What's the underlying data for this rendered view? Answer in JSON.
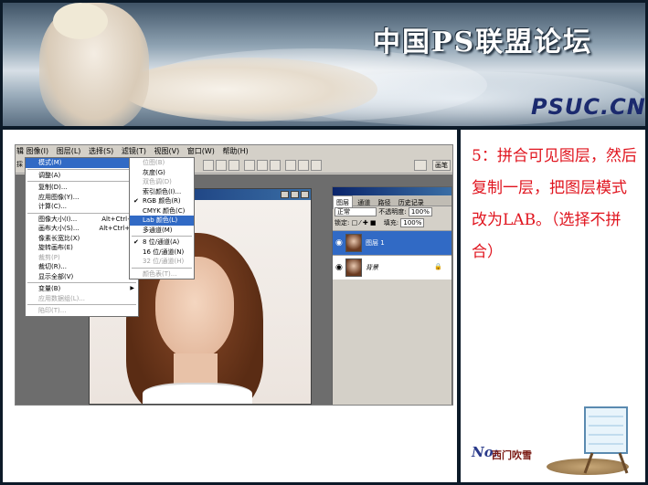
{
  "banner": {
    "title": "中国PS联盟论坛",
    "url": "PSUC.CN"
  },
  "ps": {
    "menubar": [
      "图像(I)",
      "图层(L)",
      "选择(S)",
      "滤镜(T)",
      "视图(V)",
      "窗口(W)",
      "帮助(H)"
    ],
    "left_partial": "辑",
    "tool_label": "採",
    "brush_label": "画笔"
  },
  "image_menu": [
    {
      "label": "模式(M)",
      "state": "sel",
      "arrow": true
    },
    {
      "sep": true
    },
    {
      "label": "调整(A)",
      "arrow": true
    },
    {
      "sep": true
    },
    {
      "label": "复制(D)..."
    },
    {
      "label": "应用图像(Y)..."
    },
    {
      "label": "计算(C)..."
    },
    {
      "sep": true
    },
    {
      "label": "图像大小(I)...",
      "shortcut": "Alt+Ctrl+I"
    },
    {
      "label": "画布大小(S)...",
      "shortcut": "Alt+Ctrl+C"
    },
    {
      "label": "像素长宽比(X)",
      "arrow": true
    },
    {
      "label": "旋转画布(E)",
      "arrow": true
    },
    {
      "label": "裁剪(P)",
      "state": "dis"
    },
    {
      "label": "裁切(R)..."
    },
    {
      "label": "显示全部(V)"
    },
    {
      "sep": true
    },
    {
      "label": "变量(B)",
      "arrow": true
    },
    {
      "label": "应用数据组(L)...",
      "state": "dis"
    },
    {
      "sep": true
    },
    {
      "label": "陷印(T)...",
      "state": "dis"
    }
  ],
  "mode_menu": [
    {
      "label": "位图(B)",
      "state": "dis"
    },
    {
      "label": "灰度(G)"
    },
    {
      "label": "双色调(D)",
      "state": "dis"
    },
    {
      "label": "索引颜色(I)..."
    },
    {
      "label": "RGB 颜色(R)",
      "check": true
    },
    {
      "label": "CMYK 颜色(C)"
    },
    {
      "label": "Lab 颜色(L)",
      "state": "sel"
    },
    {
      "label": "多通道(M)"
    },
    {
      "sep": true
    },
    {
      "label": "8 位/通道(A)",
      "check": true
    },
    {
      "label": "16 位/通道(N)"
    },
    {
      "label": "32 位/通道(H)",
      "state": "dis"
    },
    {
      "sep": true
    },
    {
      "label": "颜色表(T)...",
      "state": "dis"
    }
  ],
  "layers": {
    "tabs": [
      "图层",
      "通道",
      "路径",
      "历史记录"
    ],
    "blend_mode": "正常",
    "opacity_label": "不透明度:",
    "opacity": "100%",
    "lock_label": "锁定:",
    "fill_label": "填充:",
    "fill": "100%",
    "items": [
      {
        "name": "图层 1",
        "selected": true
      },
      {
        "name": "背景",
        "selected": false,
        "locked": true
      }
    ]
  },
  "step": {
    "text": "5：拼合可见图层，然后复制一层，把图层模式改为LAB。（选择不拼合）"
  },
  "logo": {
    "no": "No:",
    "name": "西门吹雪"
  },
  "colors": {
    "step_text": "#e0141e",
    "selection": "#316ac5",
    "border": "#0c1a28"
  }
}
